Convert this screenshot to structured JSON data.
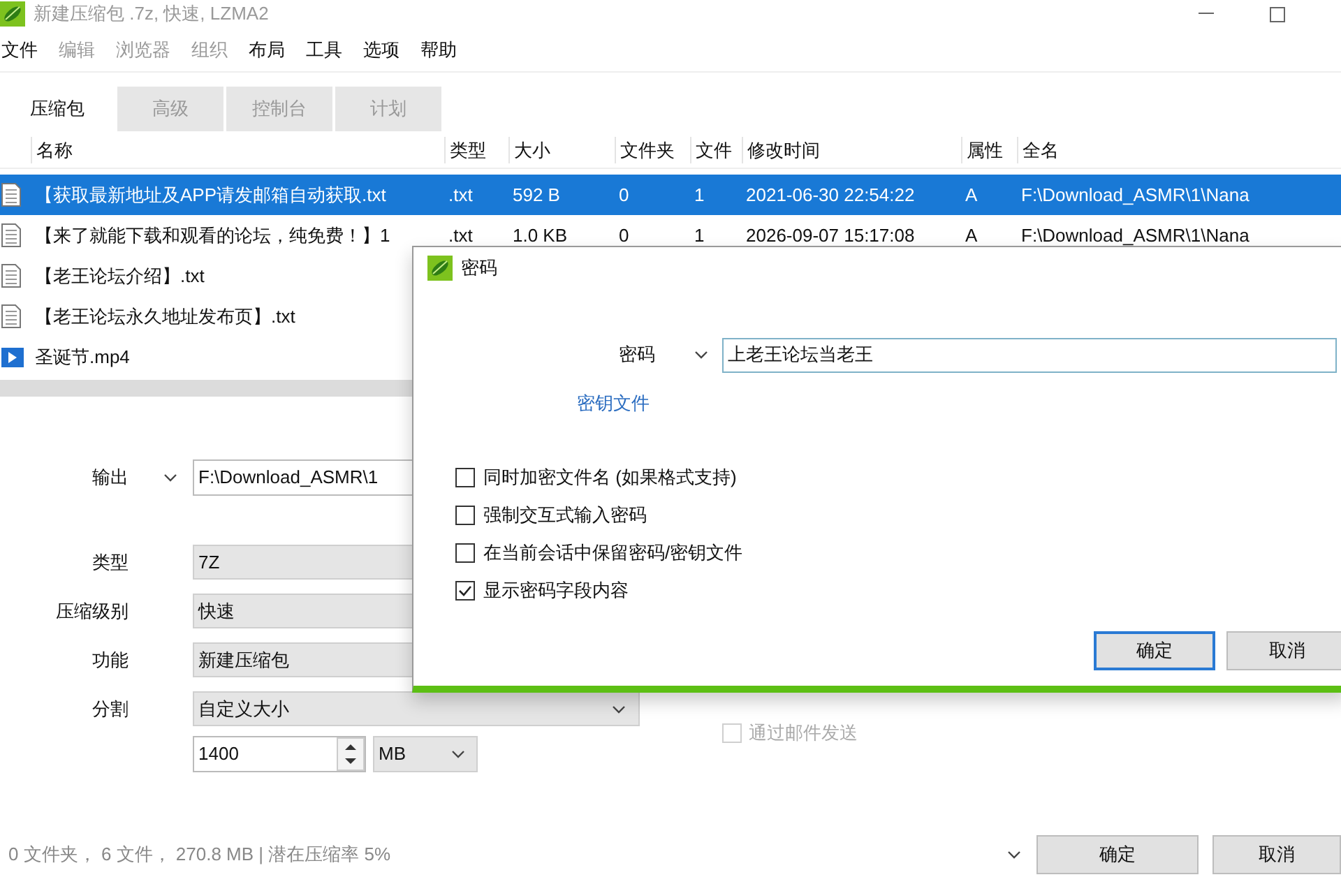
{
  "window": {
    "title": "新建压缩包 .7z, 快速, LZMA2"
  },
  "menu": [
    {
      "label": "文件",
      "disabled": false
    },
    {
      "label": "编辑",
      "disabled": true
    },
    {
      "label": "浏览器",
      "disabled": true
    },
    {
      "label": "组织",
      "disabled": true
    },
    {
      "label": "布局",
      "disabled": false
    },
    {
      "label": "工具",
      "disabled": false
    },
    {
      "label": "选项",
      "disabled": false
    },
    {
      "label": "帮助",
      "disabled": false
    }
  ],
  "tabs": [
    {
      "label": "压缩包",
      "selected": true
    },
    {
      "label": "高级",
      "selected": false
    },
    {
      "label": "控制台",
      "selected": false
    },
    {
      "label": "计划",
      "selected": false
    }
  ],
  "table": {
    "columns": [
      "名称",
      "类型",
      "大小",
      "文件夹",
      "文件",
      "修改时间",
      "属性",
      "全名"
    ],
    "rows": [
      {
        "kind": "text",
        "selected": true,
        "cells": [
          "【获取最新地址及APP请发邮箱自动获取.txt",
          ".txt",
          "592 B",
          "0",
          "1",
          "2021-06-30 22:54:22",
          "A",
          "F:\\Download_ASMR\\1\\Nana"
        ]
      },
      {
        "kind": "text",
        "selected": false,
        "cells": [
          "【来了就能下载和观看的论坛，纯免费！】1",
          ".txt",
          "1.0 KB",
          "0",
          "1",
          "2026-09-07 15:17:08",
          "A",
          "F:\\Download_ASMR\\1\\Nana"
        ]
      },
      {
        "kind": "text",
        "selected": false,
        "cells": [
          "【老王论坛介绍】.txt"
        ]
      },
      {
        "kind": "text",
        "selected": false,
        "cells": [
          "【老王论坛永久地址发布页】.txt"
        ]
      },
      {
        "kind": "video",
        "selected": false,
        "cells": [
          "圣诞节.mp4"
        ]
      }
    ]
  },
  "options": {
    "output": {
      "label": "输出",
      "value": "F:\\Download_ASMR\\1"
    },
    "type": {
      "label": "类型",
      "value": "7Z"
    },
    "level": {
      "label": "压缩级别",
      "value": "快速"
    },
    "function": {
      "label": "功能",
      "value": "新建压缩包"
    },
    "split": {
      "label": "分割",
      "value": "自定义大小",
      "size": "1400",
      "unit": "MB"
    }
  },
  "send_by_mail": {
    "label": "通过邮件发送",
    "checked": false,
    "disabled": true
  },
  "status_bar": "0 文件夹， 6 文件， 270.8 MB | 潜在压缩率 5%",
  "buttons": [
    "确定",
    "取消"
  ],
  "dialog": {
    "title": "密码",
    "password_label": "密码",
    "password": "上老王论坛当老王",
    "key_file_link": "密钥文件",
    "options": [
      {
        "label": "同时加密文件名 (如果格式支持)",
        "checked": false
      },
      {
        "label": "强制交互式输入密码",
        "checked": false
      },
      {
        "label": "在当前会话中保留密码/密钥文件",
        "checked": false
      },
      {
        "label": "显示密码字段内容",
        "checked": true
      }
    ],
    "buttons": [
      {
        "label": "确定",
        "default": true
      },
      {
        "label": "取消",
        "default": false
      }
    ]
  }
}
